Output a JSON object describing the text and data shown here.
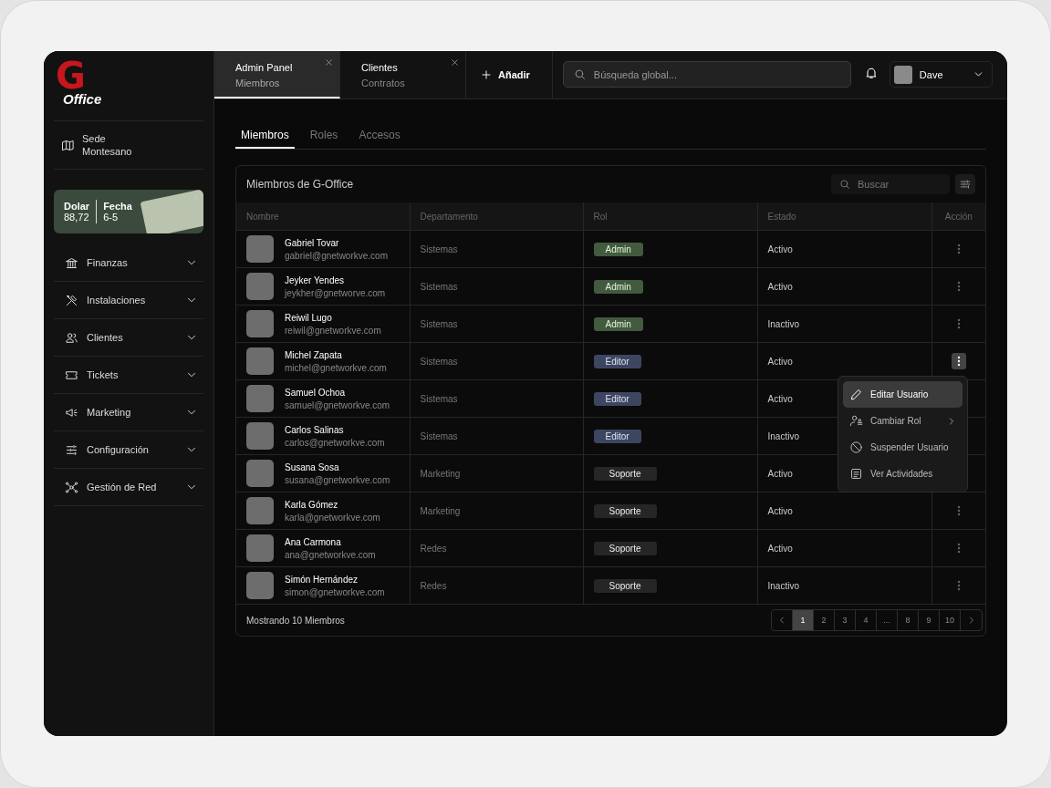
{
  "logo": {
    "letter": "G",
    "word": "Office"
  },
  "sidebar": {
    "location": {
      "label": "Sede",
      "value": "Montesano"
    },
    "rate_card": {
      "dollar_label": "Dolar",
      "dollar_value": "88,72",
      "date_label": "Fecha",
      "date_value": "6-5"
    },
    "items": [
      {
        "label": "Finanzas",
        "expanded": false
      },
      {
        "label": "Instalaciones",
        "expanded": false
      },
      {
        "label": "Clientes",
        "expanded": false
      },
      {
        "label": "Tickets",
        "expanded": false
      },
      {
        "label": "Marketing",
        "expanded": false
      },
      {
        "label": "Configuración",
        "expanded": false
      },
      {
        "label": "Gestión de Red",
        "expanded": false
      }
    ]
  },
  "tabs": [
    {
      "label": "Admin Panel",
      "sublabel": "Miembros",
      "selected": true
    },
    {
      "label": "Clientes",
      "sublabel": "Contratos",
      "selected": false
    }
  ],
  "add_button": "Añadir",
  "search": {
    "placeholder": "Búsqueda global..."
  },
  "user": {
    "name": "Dave"
  },
  "subtabs": [
    {
      "label": "Miembros",
      "selected": true
    },
    {
      "label": "Roles",
      "selected": false
    },
    {
      "label": "Accesos",
      "selected": false
    }
  ],
  "table": {
    "title": "Miembros de G-Office",
    "search_placeholder": "Buscar",
    "columns": [
      "Nombre",
      "Departamento",
      "Rol",
      "Estado",
      "Acción"
    ],
    "rows": [
      {
        "name": "Gabriel Tovar",
        "email": "gabriel@gnetworkve.com",
        "department": "Sistemas",
        "role": "Admin",
        "kind": "admin",
        "status": "Activo",
        "menu_open": false
      },
      {
        "name": "Jeyker Yendes",
        "email": "jeykher@gnetworve.com",
        "department": "Sistemas",
        "role": "Admin",
        "kind": "admin",
        "status": "Activo",
        "menu_open": false
      },
      {
        "name": "Reiwil Lugo",
        "email": "reiwil@gnetworkve.com",
        "department": "Sistemas",
        "role": "Admin",
        "kind": "admin",
        "status": "Inactivo",
        "menu_open": false
      },
      {
        "name": "Michel Zapata",
        "email": "michel@gnetworkve.com",
        "department": "Sistemas",
        "role": "Editor",
        "kind": "editor",
        "status": "Activo",
        "menu_open": true
      },
      {
        "name": "Samuel Ochoa",
        "email": "samuel@gnetworkve.com",
        "department": "Sistemas",
        "role": "Editor",
        "kind": "editor",
        "status": "Activo",
        "menu_open": false
      },
      {
        "name": "Carlos Salinas",
        "email": "carlos@gnetworkve.com",
        "department": "Sistemas",
        "role": "Editor",
        "kind": "editor",
        "status": "Inactivo",
        "menu_open": false
      },
      {
        "name": "Susana Sosa",
        "email": "susana@gnetworkve.com",
        "department": "Marketing",
        "role": "Soporte",
        "kind": "support",
        "status": "Activo",
        "menu_open": false
      },
      {
        "name": "Karla Gómez",
        "email": "karla@gnetworkve.com",
        "department": "Marketing",
        "role": "Soporte",
        "kind": "support",
        "status": "Activo",
        "menu_open": false
      },
      {
        "name": "Ana Carmona",
        "email": "ana@gnetworkve.com",
        "department": "Redes",
        "role": "Soporte",
        "kind": "support",
        "status": "Activo",
        "menu_open": false
      },
      {
        "name": "Simón Hernández",
        "email": "simon@gnetworkve.com",
        "department": "Redes",
        "role": "Soporte",
        "kind": "support",
        "status": "Inactivo",
        "menu_open": false
      }
    ],
    "footer": "Mostrando 10 Miembros",
    "pages": [
      {
        "label": "1",
        "selected": true
      },
      {
        "label": "2",
        "selected": false
      },
      {
        "label": "3",
        "selected": false
      },
      {
        "label": "4",
        "selected": false
      },
      {
        "label": "...",
        "selected": false
      },
      {
        "label": "8",
        "selected": false
      },
      {
        "label": "9",
        "selected": false
      },
      {
        "label": "10",
        "selected": false
      }
    ]
  },
  "context_menu": [
    {
      "label": "Editar Usuario",
      "selected": true,
      "submenu": false
    },
    {
      "label": "Cambiar Rol",
      "selected": false,
      "submenu": true
    },
    {
      "label": "Suspender Usuario",
      "selected": false,
      "submenu": false
    },
    {
      "label": "Ver Actividades",
      "selected": false,
      "submenu": false
    }
  ]
}
